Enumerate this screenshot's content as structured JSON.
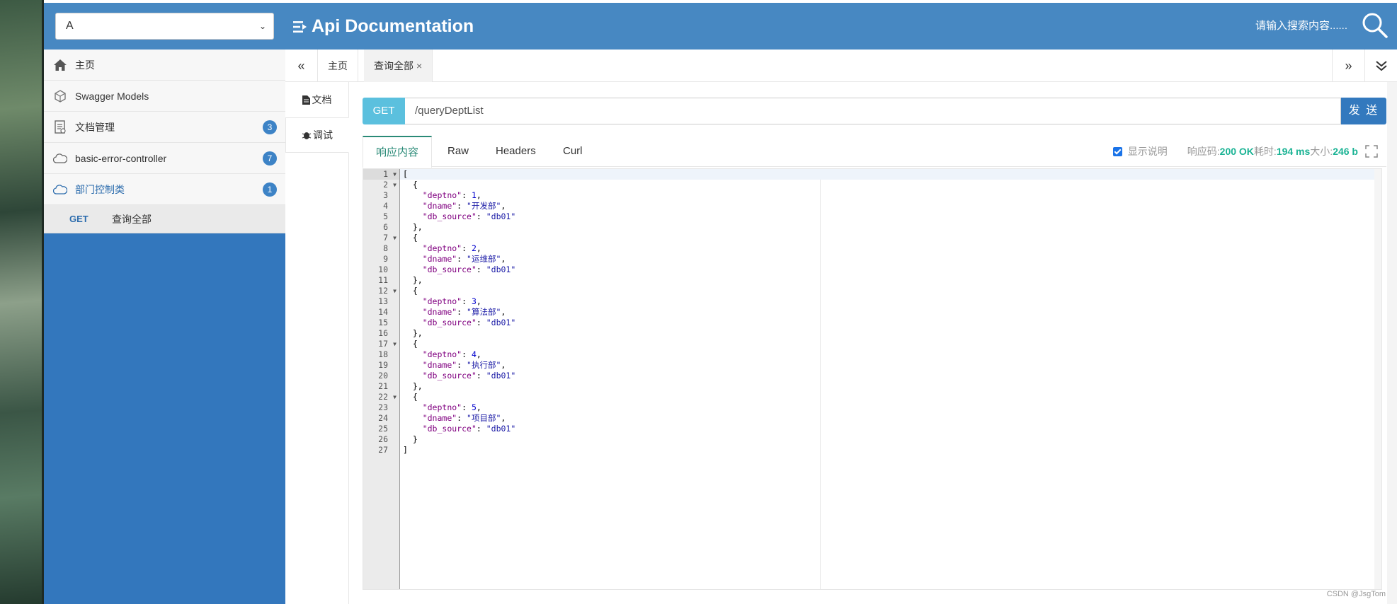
{
  "header": {
    "group_select": "A",
    "title": "Api Documentation",
    "search_placeholder": "请输入搜索内容......"
  },
  "sidebar": {
    "items": [
      {
        "label": "主页",
        "icon": "home-icon"
      },
      {
        "label": "Swagger Models",
        "icon": "cube-icon"
      },
      {
        "label": "文档管理",
        "icon": "document-icon",
        "badge": "3"
      },
      {
        "label": "basic-error-controller",
        "icon": "cloud-icon",
        "badge": "7"
      },
      {
        "label": "部门控制类",
        "icon": "cloud-icon",
        "badge": "1"
      }
    ],
    "sub_items": [
      {
        "method": "GET",
        "label": "查询全部"
      }
    ]
  },
  "tabbar": {
    "tabs": [
      {
        "label": "主页"
      },
      {
        "label": "查询全部",
        "close": "×"
      }
    ]
  },
  "doc_tabs": {
    "doc": "文档",
    "debug": "调试"
  },
  "request": {
    "method": "GET",
    "url": "/queryDeptList",
    "send": "发 送"
  },
  "response": {
    "tabs": [
      "响应内容",
      "Raw",
      "Headers",
      "Curl"
    ],
    "show_desc": "显示说明",
    "code_label": "响应码:",
    "code_value": "200 OK",
    "time_label": "耗时:",
    "time_value": "194 ms",
    "size_label": "大小:",
    "size_value": "246 b"
  },
  "code_lines": [
    "[",
    "  {",
    "    \"deptno\": 1,",
    "    \"dname\": \"开发部\",",
    "    \"db_source\": \"db01\"",
    "  },",
    "  {",
    "    \"deptno\": 2,",
    "    \"dname\": \"运维部\",",
    "    \"db_source\": \"db01\"",
    "  },",
    "  {",
    "    \"deptno\": 3,",
    "    \"dname\": \"算法部\",",
    "    \"db_source\": \"db01\"",
    "  },",
    "  {",
    "    \"deptno\": 4,",
    "    \"dname\": \"执行部\",",
    "    \"db_source\": \"db01\"",
    "  },",
    "  {",
    "    \"deptno\": 5,",
    "    \"dname\": \"项目部\",",
    "    \"db_source\": \"db01\"",
    "  }",
    "]"
  ],
  "fold_lines": [
    1,
    2,
    7,
    12,
    17,
    22
  ],
  "watermark": "CSDN @JsgTom",
  "colors": {
    "header": "#4788c2",
    "sidebar": "#3377bd",
    "method_badge": "#5bc0de",
    "send": "#3379be",
    "active_tab": "#2a8a77",
    "status_green": "#1ab394"
  }
}
